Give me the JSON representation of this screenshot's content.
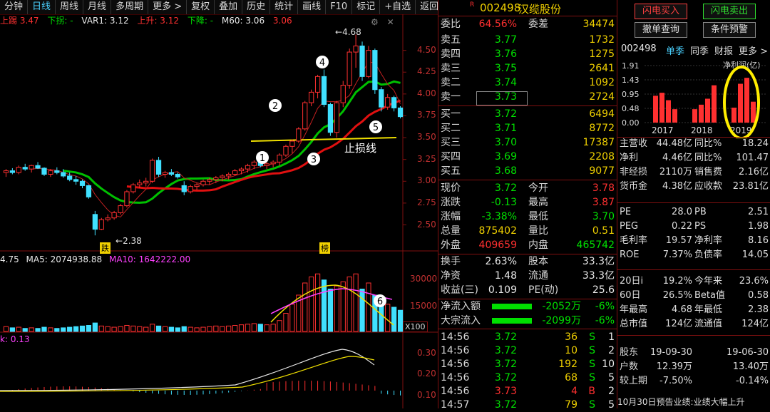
{
  "toolbar": {
    "items": [
      "分钟",
      "日线",
      "周线",
      "月线",
      "多周期",
      "更多 >",
      "复权",
      "叠加",
      "历史",
      "统计",
      "画线",
      "F10",
      "标记",
      "+自选",
      "返回"
    ],
    "active_index": 1
  },
  "indicators": {
    "line1": "上踢 3.47",
    "line2": "下拐: -",
    "line3": "VAR1: 3.12",
    "line4": "上升: 3.12",
    "line5": "下降: -",
    "line6": "M60: 3.06",
    "line7": "3.06"
  },
  "price_axis": [
    "4.50",
    "4.25",
    "4.00",
    "3.75",
    "3.50",
    "3.25",
    "3.00",
    "2.75",
    "2.50"
  ],
  "annotations": {
    "high": "4.68",
    "low": "2.38",
    "stoploss": "止损线",
    "markers": [
      "1",
      "2",
      "3",
      "4",
      "5"
    ],
    "tag_die": "跌",
    "tag_bang": "榜"
  },
  "volume": {
    "header_vol": "4.75",
    "ma5": "MA5: 2074938.88",
    "ma10": "MA10: 1642222.00",
    "axis": [
      "30000",
      "15000"
    ],
    "unit": "X100",
    "marker": "6"
  },
  "macd": {
    "header": "0.13",
    "axis": [
      "0.30",
      "0.20",
      "0.10"
    ]
  },
  "panel": {
    "flag": "R",
    "code": "002498",
    "name": "汉缆股份",
    "weibi_label": "委比",
    "weibi": "64.56%",
    "weicha_label": "委差",
    "weicha": "34474",
    "asks": [
      {
        "label": "卖五",
        "price": "3.77",
        "vol": "1732"
      },
      {
        "label": "卖四",
        "price": "3.76",
        "vol": "1275"
      },
      {
        "label": "卖三",
        "price": "3.75",
        "vol": "2641"
      },
      {
        "label": "卖二",
        "price": "3.74",
        "vol": "1092"
      },
      {
        "label": "卖一",
        "price": "3.73",
        "vol": "2724"
      }
    ],
    "bids": [
      {
        "label": "买一",
        "price": "3.72",
        "vol": "6494"
      },
      {
        "label": "买二",
        "price": "3.71",
        "vol": "8772"
      },
      {
        "label": "买三",
        "price": "3.70",
        "vol": "17387"
      },
      {
        "label": "买四",
        "price": "3.69",
        "vol": "2208"
      },
      {
        "label": "买五",
        "price": "3.68",
        "vol": "9077"
      }
    ],
    "quote": [
      {
        "l1": "现价",
        "v1": "3.72",
        "l2": "今开",
        "v2": "3.78"
      },
      {
        "l1": "涨跌",
        "v1": "-0.13",
        "l2": "最高",
        "v2": "3.87"
      },
      {
        "l1": "涨幅",
        "v1": "-3.38%",
        "l2": "最低",
        "v2": "3.70"
      },
      {
        "l1": "总量",
        "v1": "875402",
        "l2": "量比",
        "v2": "0.51"
      },
      {
        "l1": "外盘",
        "v1": "409659",
        "l2": "内盘",
        "v2": "465742"
      }
    ],
    "stats": [
      {
        "l1": "换手",
        "v1": "2.63%",
        "l2": "股本",
        "v2": "33.3亿"
      },
      {
        "l1": "净资",
        "v1": "1.48",
        "l2": "流通",
        "v2": "33.3亿"
      },
      {
        "l1": "收益(三)",
        "v1": "0.109",
        "l2": "PE(动)",
        "v2": "25.6"
      }
    ],
    "flows": [
      {
        "label": "净流入额",
        "value": "-2052万",
        "pct": "-6%"
      },
      {
        "label": "大宗流入",
        "value": "-2099万",
        "pct": "-6%"
      }
    ],
    "ticks": [
      {
        "time": "14:56",
        "price": "3.72",
        "vol": "36",
        "side": "S",
        "n": "1"
      },
      {
        "time": "14:56",
        "price": "3.72",
        "vol": "10",
        "side": "S",
        "n": "2"
      },
      {
        "time": "14:56",
        "price": "3.72",
        "vol": "192",
        "side": "S",
        "n": "10"
      },
      {
        "time": "14:56",
        "price": "3.72",
        "vol": "68",
        "side": "S",
        "n": "5"
      },
      {
        "time": "14:56",
        "price": "3.73",
        "vol": "4",
        "side": "B",
        "n": "2"
      },
      {
        "time": "14:57",
        "price": "3.72",
        "vol": "79",
        "side": "S",
        "n": "5"
      }
    ]
  },
  "fund": {
    "btn_buy": "闪电买入",
    "btn_sell": "闪电卖出",
    "btn_query": "撤单查询",
    "btn_alert": "条件预警",
    "code": "002498",
    "tabs": [
      "单季",
      "同季",
      "财报",
      "更多 >"
    ],
    "chart_label": "净利润(亿)",
    "chart_axis": [
      "1.91",
      "1.43",
      "0.95",
      "0.48",
      "0.00"
    ],
    "years": [
      "2017",
      "2018",
      "2019"
    ],
    "rows": [
      {
        "l1": "主营收",
        "v1": "44.48亿",
        "l2": "同比%",
        "v2": "18.24"
      },
      {
        "l1": "净利",
        "v1": "4.46亿",
        "l2": "同比%",
        "v2": "101.47"
      },
      {
        "l1": "非经损",
        "v1": "2110万",
        "l2": "销售费",
        "v2": "2.16亿"
      },
      {
        "l1": "货币金",
        "v1": "4.38亿",
        "l2": "应收款",
        "v2": "23.81亿"
      }
    ],
    "rows2": [
      {
        "l1": "PE",
        "v1": "28.0",
        "l2": "PB",
        "v2": "2.51"
      },
      {
        "l1": "PEG",
        "v1": "0.22",
        "l2": "PS",
        "v2": "1.98"
      },
      {
        "l1": "毛利率",
        "v1": "19.57",
        "l2": "净利率",
        "v2": "8.16"
      },
      {
        "l1": "ROE",
        "v1": "7.37%",
        "l2": "负债率",
        "v2": "14.05"
      }
    ],
    "rows3": [
      {
        "l1": "20日i",
        "v1": "19.2%",
        "l2": "今年来",
        "v2": "23.6%"
      },
      {
        "l1": "60日",
        "v1": "26.5%",
        "l2": "Beta值",
        "v2": "0.58"
      },
      {
        "l1": "年最高",
        "v1": "4.68",
        "l2": "年最低",
        "v2": "2.38"
      },
      {
        "l1": "总市值",
        "v1": "124亿",
        "l2": "流通值",
        "v2": "124亿"
      }
    ],
    "rows4": [
      {
        "l1": "股东",
        "v1": "19-09-30",
        "v2": "19-06-30"
      },
      {
        "l1": "户数",
        "v1": "12.39万",
        "v2": "13.40万"
      },
      {
        "l1": "较上期",
        "v1": "-7.50%",
        "v2": "-0.14%"
      }
    ],
    "footer": "10月30日预告业绩:业绩大幅上升"
  },
  "chart_data": {
    "type": "candlestick",
    "ylim": [
      2.3,
      4.75
    ],
    "candles": [
      [
        3.1,
        3.14,
        3.05,
        3.12
      ],
      [
        3.12,
        3.15,
        3.08,
        3.1
      ],
      [
        3.1,
        3.18,
        3.08,
        3.16
      ],
      [
        3.16,
        3.2,
        3.12,
        3.14
      ],
      [
        3.14,
        3.19,
        3.1,
        3.18
      ],
      [
        3.18,
        3.22,
        3.14,
        3.15
      ],
      [
        3.15,
        3.16,
        3.06,
        3.08
      ],
      [
        3.08,
        3.14,
        3.05,
        3.12
      ],
      [
        3.12,
        3.16,
        3.08,
        3.1
      ],
      [
        3.1,
        3.14,
        3.04,
        3.06
      ],
      [
        3.06,
        3.1,
        3.0,
        3.02
      ],
      [
        3.02,
        3.06,
        2.96,
        3.0
      ],
      [
        3.0,
        3.02,
        2.92,
        2.95
      ],
      [
        2.95,
        2.96,
        2.8,
        2.82
      ],
      [
        2.62,
        2.66,
        2.38,
        2.45
      ],
      [
        2.45,
        2.58,
        2.44,
        2.56
      ],
      [
        2.56,
        2.62,
        2.54,
        2.58
      ],
      [
        2.58,
        2.66,
        2.56,
        2.64
      ],
      [
        2.64,
        2.74,
        2.62,
        2.72
      ],
      [
        2.72,
        2.9,
        2.7,
        2.88
      ],
      [
        2.88,
        2.98,
        2.86,
        2.96
      ],
      [
        2.96,
        3.02,
        2.92,
        2.98
      ],
      [
        2.98,
        3.04,
        2.94,
        3.0
      ],
      [
        3.0,
        3.26,
        2.98,
        3.24
      ],
      [
        3.24,
        3.28,
        3.05,
        3.08
      ],
      [
        3.08,
        3.12,
        3.04,
        3.1
      ],
      [
        3.1,
        3.14,
        3.06,
        3.08
      ],
      [
        3.08,
        3.1,
        3.03,
        3.05
      ],
      [
        2.95,
        3.0,
        2.84,
        2.88
      ],
      [
        2.88,
        2.96,
        2.86,
        2.94
      ],
      [
        2.94,
        2.98,
        2.9,
        2.96
      ],
      [
        2.96,
        3.02,
        2.94,
        3.0
      ],
      [
        3.0,
        3.04,
        2.96,
        3.02
      ],
      [
        3.02,
        3.06,
        2.98,
        3.04
      ],
      [
        3.04,
        3.08,
        3.0,
        3.06
      ],
      [
        3.06,
        3.1,
        3.02,
        3.08
      ],
      [
        3.08,
        3.14,
        3.06,
        3.12
      ],
      [
        3.12,
        3.16,
        3.08,
        3.14
      ],
      [
        3.14,
        3.2,
        3.1,
        3.18
      ],
      [
        3.18,
        3.24,
        3.14,
        3.22
      ],
      [
        3.22,
        3.25,
        3.16,
        3.18
      ],
      [
        3.18,
        3.22,
        3.14,
        3.2
      ],
      [
        3.2,
        3.24,
        3.16,
        3.22
      ],
      [
        3.22,
        3.32,
        3.18,
        3.3
      ],
      [
        3.3,
        3.42,
        3.28,
        3.4
      ],
      [
        3.4,
        3.48,
        3.32,
        3.46
      ],
      [
        3.46,
        3.62,
        3.44,
        3.6
      ],
      [
        3.6,
        3.92,
        3.58,
        3.9
      ],
      [
        3.9,
        4.05,
        3.86,
        4.02
      ],
      [
        4.02,
        4.22,
        3.95,
        4.2
      ],
      [
        4.2,
        4.28,
        3.85,
        3.88
      ],
      [
        3.88,
        3.9,
        3.52,
        3.56
      ],
      [
        3.56,
        3.92,
        3.5,
        3.9
      ],
      [
        3.9,
        4.15,
        3.85,
        4.1
      ],
      [
        4.1,
        4.52,
        4.06,
        4.48
      ],
      [
        4.48,
        4.68,
        4.3,
        4.55
      ],
      [
        4.55,
        4.6,
        4.15,
        4.2
      ],
      [
        4.2,
        4.55,
        4.18,
        4.5
      ],
      [
        4.5,
        4.52,
        4.0,
        4.05
      ],
      [
        4.05,
        4.08,
        3.8,
        3.85
      ],
      [
        3.85,
        4.0,
        3.82,
        3.96
      ],
      [
        3.96,
        3.98,
        3.8,
        3.84
      ],
      [
        3.84,
        3.86,
        3.72,
        3.74
      ]
    ]
  }
}
